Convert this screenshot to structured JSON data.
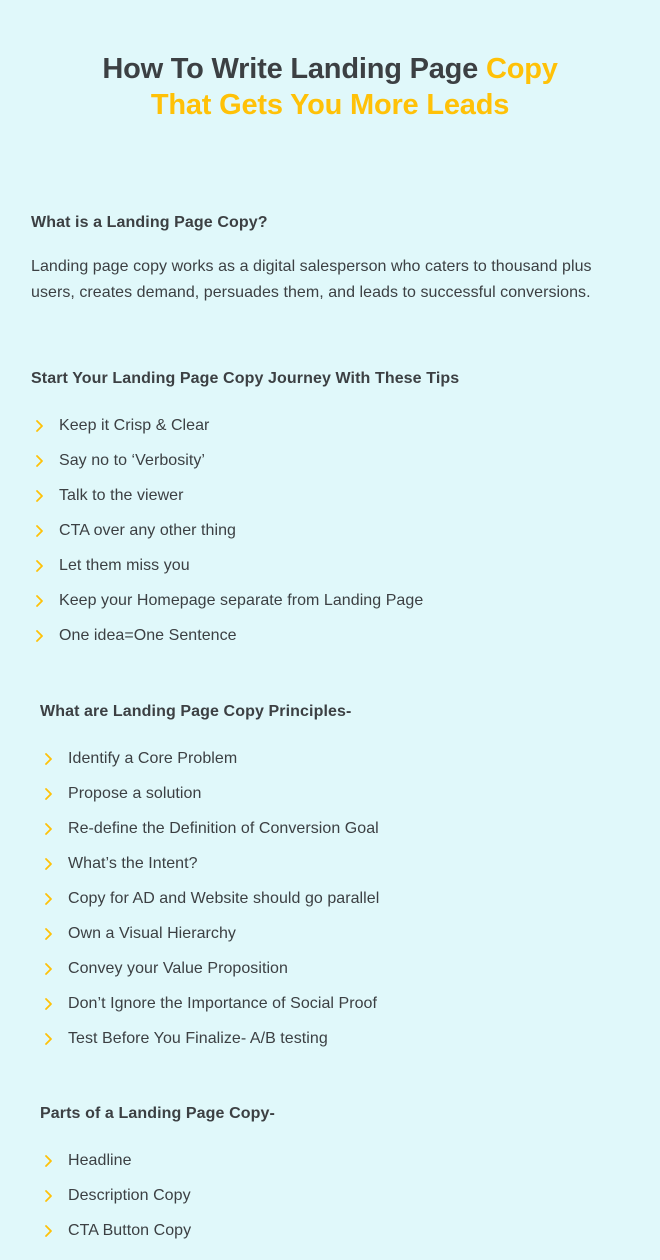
{
  "theme": {
    "background": "#e0f8fa",
    "text": "#3c4043",
    "accent": "#ffc107"
  },
  "title": {
    "line1_dark": "How To Write Landing Page ",
    "line1_accent": "Copy",
    "line2_accent": "That Gets You More Leads"
  },
  "sections": [
    {
      "heading": "What is a Landing Page Copy?",
      "paragraph": "Landing page copy works as a digital salesperson who caters to thousand plus users, creates demand, persuades them, and leads to successful conversions."
    },
    {
      "heading": "Start Your Landing Page Copy Journey With These Tips",
      "items": [
        "Keep it Crisp & Clear",
        "Say no to ‘Verbosity’",
        "Talk to the viewer",
        "CTA over any other thing",
        "Let them miss you",
        "Keep your Homepage separate from Landing Page",
        "One idea=One Sentence"
      ]
    },
    {
      "heading": "What are Landing Page Copy Principles-",
      "items": [
        "Identify a Core Problem",
        "Propose a solution",
        "Re-define the Definition of Conversion Goal",
        "What’s the Intent?",
        "Copy for AD and Website should go parallel",
        "Own a Visual Hierarchy",
        "Convey your Value Proposition",
        "Don’t Ignore the Importance of Social Proof",
        "Test Before You Finalize- A/B testing"
      ]
    },
    {
      "heading": "Parts of a Landing Page Copy-",
      "items": [
        "Headline",
        "Description Copy",
        "CTA Button Copy"
      ]
    }
  ],
  "icons": {
    "bullet": "chevron-right-icon"
  }
}
